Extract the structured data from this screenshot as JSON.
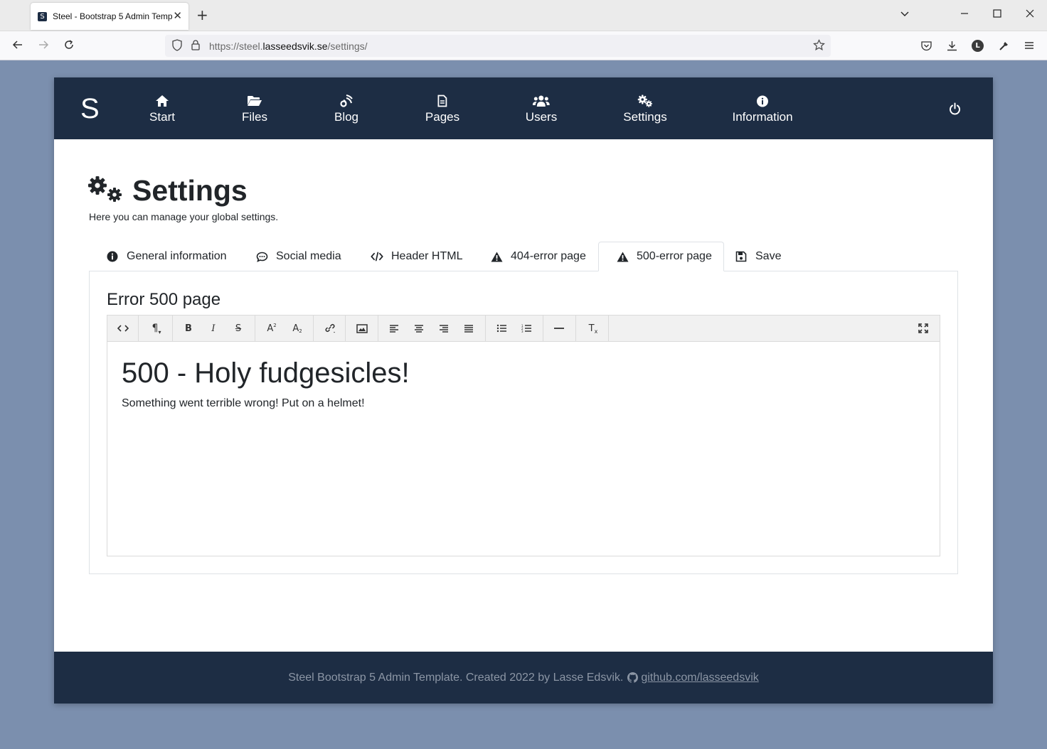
{
  "browser": {
    "tab_title": "Steel - Bootstrap 5 Admin Temp",
    "tab_favicon_letter": "S",
    "url_prefix": "https://steel.",
    "url_domain": "lasseedsvik.se",
    "url_path": "/settings/",
    "profile_letter": "L"
  },
  "app": {
    "brand": "S",
    "nav": [
      {
        "label": "Start",
        "icon": "home-icon"
      },
      {
        "label": "Files",
        "icon": "folder-open-icon"
      },
      {
        "label": "Blog",
        "icon": "blog-icon"
      },
      {
        "label": "Pages",
        "icon": "file-icon"
      },
      {
        "label": "Users",
        "icon": "users-icon"
      },
      {
        "label": "Settings",
        "icon": "cogs-icon"
      },
      {
        "label": "Information",
        "icon": "info-circle-icon"
      }
    ],
    "power_icon": "power-icon"
  },
  "page": {
    "title": "Settings",
    "description": "Here you can manage your global settings."
  },
  "tabs": [
    {
      "label": "General information",
      "icon": "info-circle-icon"
    },
    {
      "label": "Social media",
      "icon": "comment-icon"
    },
    {
      "label": "Header HTML",
      "icon": "code-icon"
    },
    {
      "label": "404-error page",
      "icon": "warning-icon"
    },
    {
      "label": "500-error page",
      "icon": "warning-icon",
      "active": true
    },
    {
      "label": "Save",
      "icon": "save-icon"
    }
  ],
  "panel": {
    "title": "Error 500 page"
  },
  "editor": {
    "heading": "500 - Holy fudgesicles!",
    "paragraph": "Something went terrible wrong! Put on a helmet!"
  },
  "footer": {
    "text": "Steel Bootstrap 5 Admin Template. Created 2022 by Lasse Edsvik.",
    "link": "github.com/lasseedsvik"
  }
}
